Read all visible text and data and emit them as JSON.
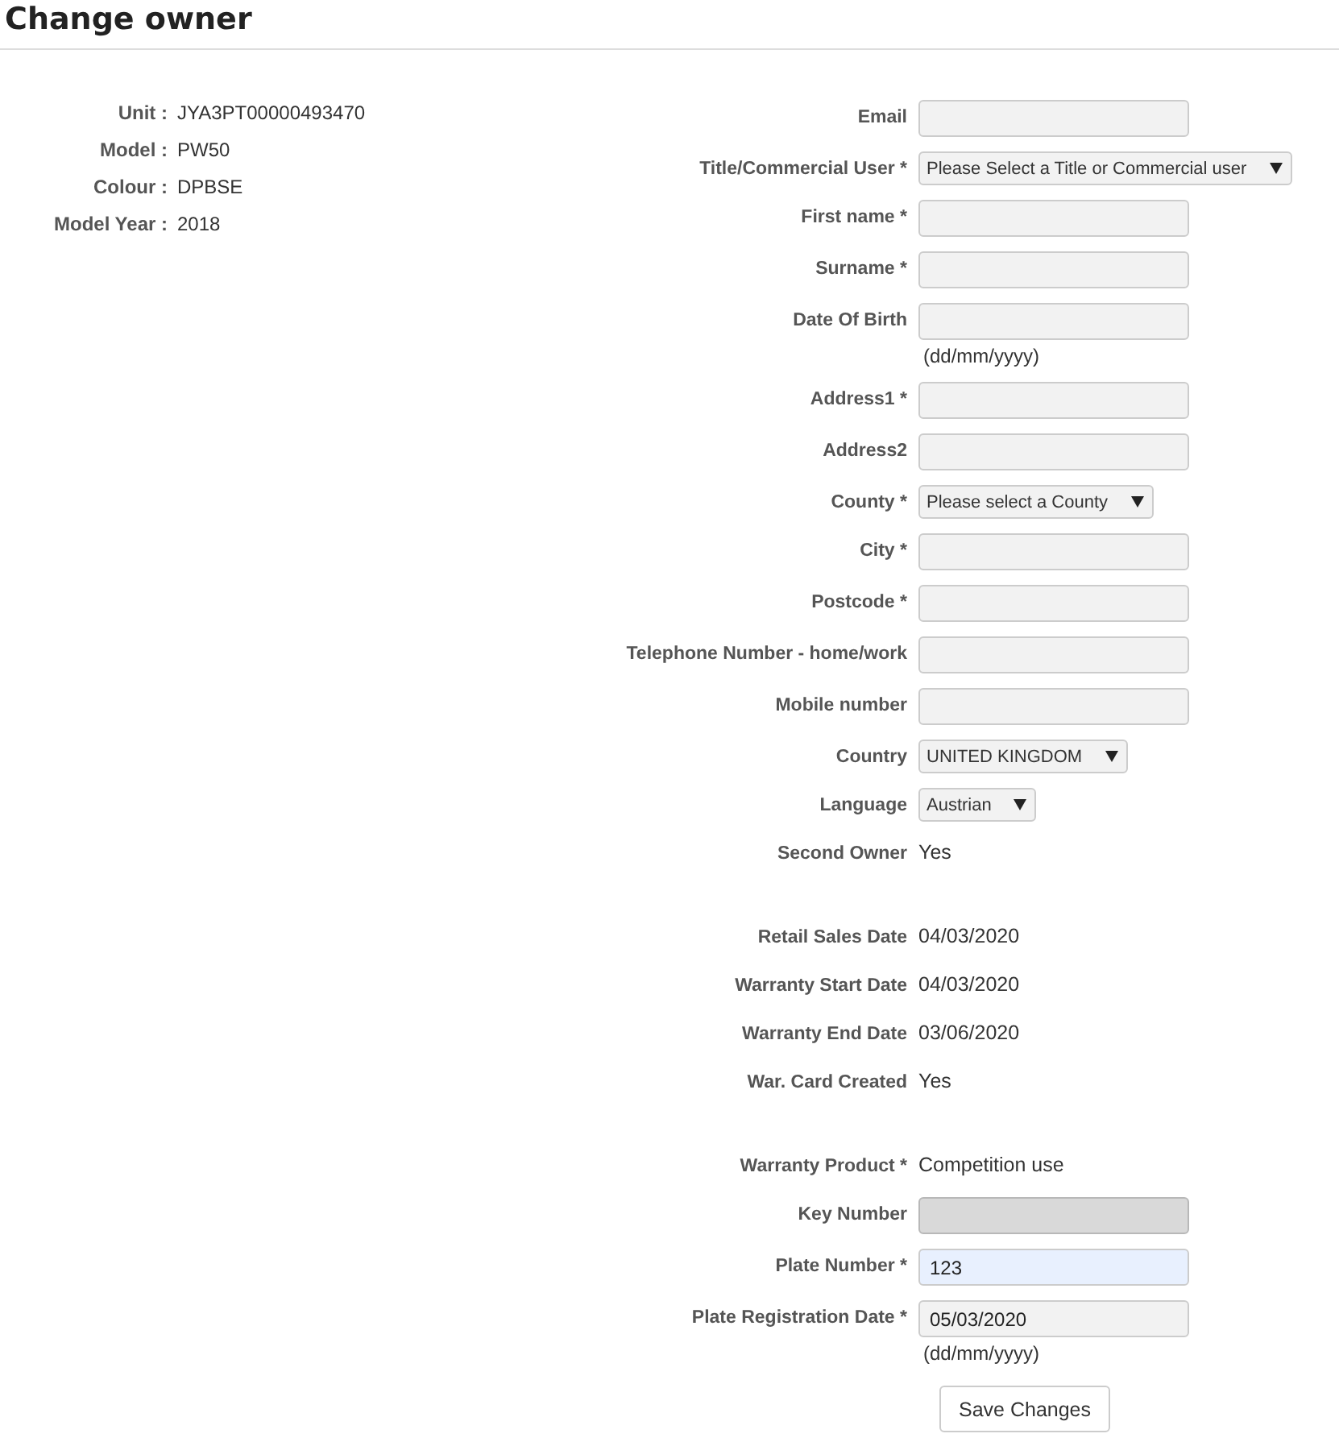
{
  "title": "Change owner",
  "unit_info": [
    {
      "label": "Unit :",
      "value": "JYA3PT00000493470"
    },
    {
      "label": "Model :",
      "value": "PW50"
    },
    {
      "label": "Colour :",
      "value": "DPBSE"
    },
    {
      "label": "Model Year :",
      "value": "2018"
    }
  ],
  "form": [
    {
      "kind": "input",
      "label": "Email",
      "disabled": false,
      "autofilled": false
    },
    {
      "kind": "select",
      "label": "Title/Commercial User *",
      "value": "Please Select a Title or Commercial user"
    },
    {
      "kind": "input",
      "label": "First name *",
      "disabled": false,
      "autofilled": false
    },
    {
      "kind": "input",
      "label": "Surname *",
      "disabled": false,
      "autofilled": false
    },
    {
      "kind": "input",
      "label": "Date Of Birth",
      "hint": "(dd/mm/yyyy)",
      "disabled": false,
      "autofilled": false
    },
    {
      "kind": "input",
      "label": "Address1 *",
      "disabled": false,
      "autofilled": false
    },
    {
      "kind": "input",
      "label": "Address2",
      "disabled": false,
      "autofilled": false
    },
    {
      "kind": "select",
      "label": "County *",
      "value": "Please select a County"
    },
    {
      "kind": "input",
      "label": "City *",
      "disabled": false,
      "autofilled": false
    },
    {
      "kind": "input",
      "label": "Postcode *",
      "disabled": false,
      "autofilled": false
    },
    {
      "kind": "input",
      "label": "Telephone Number - home/work",
      "disabled": false,
      "autofilled": false
    },
    {
      "kind": "input",
      "label": "Mobile number",
      "disabled": false,
      "autofilled": false
    },
    {
      "kind": "select",
      "label": "Country",
      "value": "UNITED KINGDOM"
    },
    {
      "kind": "select",
      "label": "Language",
      "value": "Austrian"
    },
    {
      "kind": "text",
      "label": "Second Owner",
      "value": "Yes"
    },
    {
      "kind": "spacer"
    },
    {
      "kind": "text",
      "label": "Retail Sales Date",
      "value": "04/03/2020"
    },
    {
      "kind": "text",
      "label": "Warranty Start Date",
      "value": "04/03/2020"
    },
    {
      "kind": "text",
      "label": "Warranty End Date",
      "value": "03/06/2020"
    },
    {
      "kind": "text",
      "label": "War. Card Created",
      "value": "Yes"
    },
    {
      "kind": "spacer"
    },
    {
      "kind": "text",
      "label": "Warranty Product *",
      "value": "Competition use"
    },
    {
      "kind": "input",
      "label": "Key Number",
      "disabled": true,
      "autofilled": false
    },
    {
      "kind": "input",
      "label": "Plate Number *",
      "value": "123",
      "disabled": false,
      "autofilled": true
    },
    {
      "kind": "input",
      "label": "Plate Registration Date *",
      "value": "05/03/2020",
      "hint": "(dd/mm/yyyy)",
      "disabled": false,
      "autofilled": false
    }
  ],
  "save_button": "Save Changes"
}
